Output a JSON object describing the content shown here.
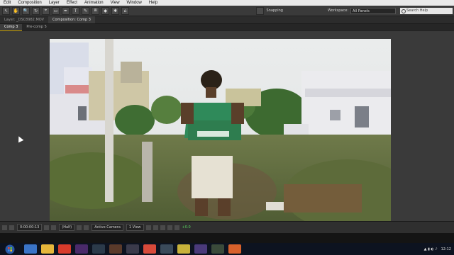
{
  "menubar": {
    "items": [
      "Edit",
      "Composition",
      "Layer",
      "Effect",
      "Animation",
      "View",
      "Window",
      "Help"
    ]
  },
  "toolbar": {
    "tools": [
      "↖",
      "✋",
      "🔍",
      "↻",
      "⌖",
      "▭",
      "✒",
      "T",
      "✎",
      "⧈",
      "◆",
      "✱",
      "⌂"
    ],
    "snapping_label": "Snapping",
    "workspace_label": "Workspace:",
    "workspace_value": "All Panels",
    "search_placeholder": "Search Help"
  },
  "panel_header": {
    "layer_tab": "Layer: _DSC8982.MOV",
    "composition_tab": "Composition: Comp 3"
  },
  "comp_tabs": [
    "Comp 3",
    "Pre-comp 5"
  ],
  "bottom_bar": {
    "zoom": "",
    "timecode": "0:00:00:13",
    "resolution": "(Half)",
    "camera": "Active Camera",
    "view": "1 View",
    "exposure": "+0.0"
  },
  "taskbar": {
    "clock": "12:12"
  },
  "colors": {
    "menubar_bg": "#e9e9e9",
    "panel_bg": "#3a3a3a",
    "accent": "#c6a000",
    "taskbar_bg": "#0d1320"
  }
}
